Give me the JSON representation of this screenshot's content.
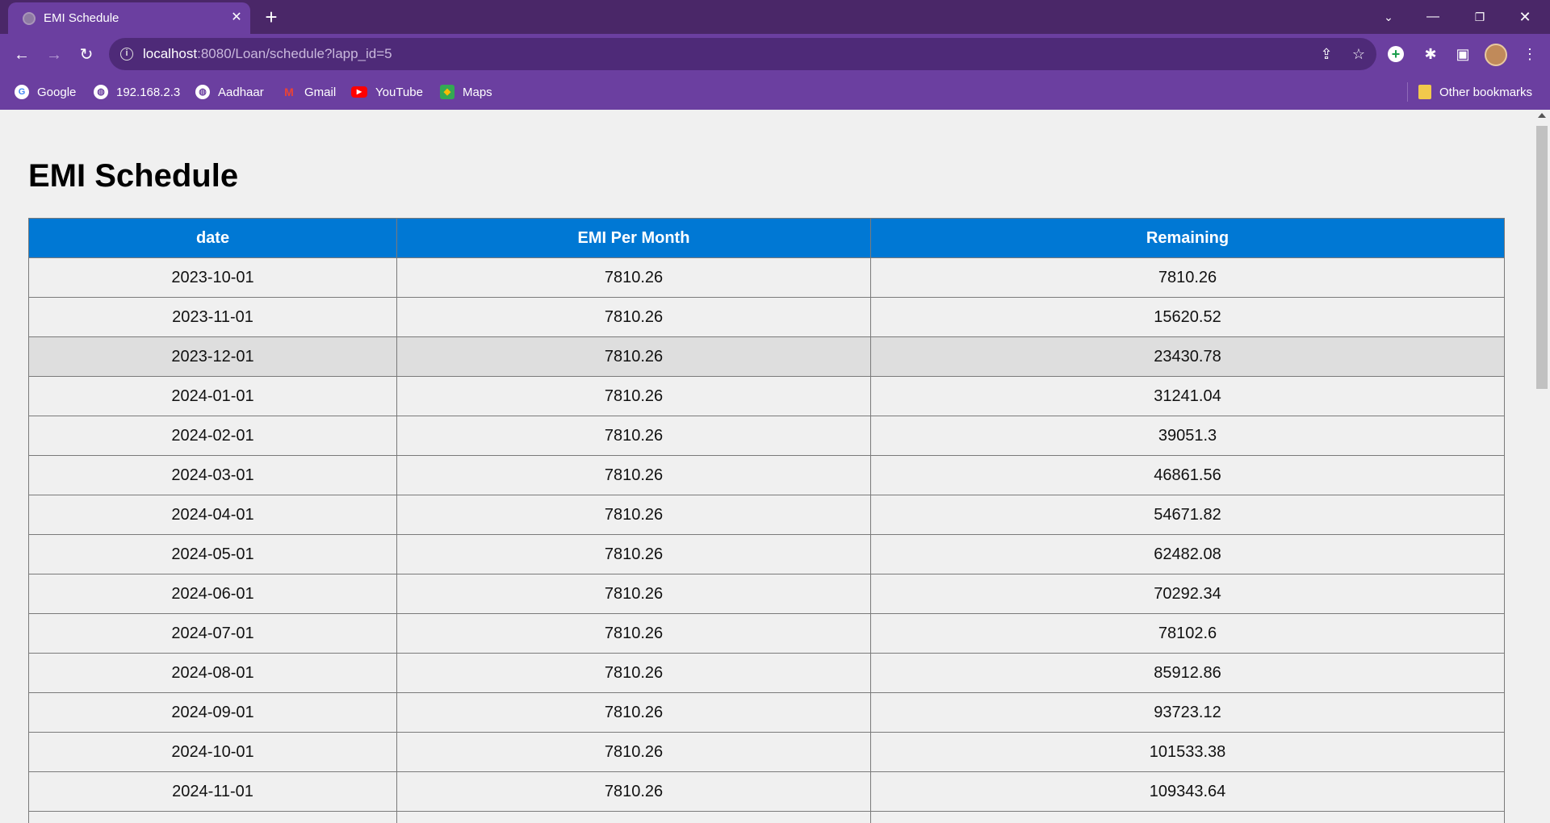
{
  "browser": {
    "tab_title": "EMI Schedule",
    "url_host": "localhost",
    "url_rest": ":8080/Loan/schedule?lapp_id=5",
    "bookmarks": [
      {
        "label": "Google",
        "icon": "google-icon",
        "color": "#ea4335"
      },
      {
        "label": "192.168.2.3",
        "icon": "globe-icon",
        "color": "#ffffff"
      },
      {
        "label": "Aadhaar",
        "icon": "globe-icon",
        "color": "#ffffff"
      },
      {
        "label": "Gmail",
        "icon": "gmail-icon",
        "color": "#ea4335"
      },
      {
        "label": "YouTube",
        "icon": "youtube-icon",
        "color": "#ff0000"
      },
      {
        "label": "Maps",
        "icon": "maps-icon",
        "color": "#34a853"
      }
    ],
    "other_bookmarks": "Other bookmarks"
  },
  "page": {
    "title": "EMI Schedule",
    "columns": [
      "date",
      "EMI Per Month",
      "Remaining"
    ],
    "rows": [
      [
        "2023-10-01",
        "7810.26",
        "7810.26"
      ],
      [
        "2023-11-01",
        "7810.26",
        "15620.52"
      ],
      [
        "2023-12-01",
        "7810.26",
        "23430.78"
      ],
      [
        "2024-01-01",
        "7810.26",
        "31241.04"
      ],
      [
        "2024-02-01",
        "7810.26",
        "39051.3"
      ],
      [
        "2024-03-01",
        "7810.26",
        "46861.56"
      ],
      [
        "2024-04-01",
        "7810.26",
        "54671.82"
      ],
      [
        "2024-05-01",
        "7810.26",
        "62482.08"
      ],
      [
        "2024-06-01",
        "7810.26",
        "70292.34"
      ],
      [
        "2024-07-01",
        "7810.26",
        "78102.6"
      ],
      [
        "2024-08-01",
        "7810.26",
        "85912.86"
      ],
      [
        "2024-09-01",
        "7810.26",
        "93723.12"
      ],
      [
        "2024-10-01",
        "7810.26",
        "101533.38"
      ],
      [
        "2024-11-01",
        "7810.26",
        "109343.64"
      ],
      [
        "",
        "",
        ""
      ]
    ],
    "colors": {
      "header_bg": "#0078d4",
      "hover_row": "#dedede",
      "browser_theme": "#6b3fa0"
    }
  }
}
